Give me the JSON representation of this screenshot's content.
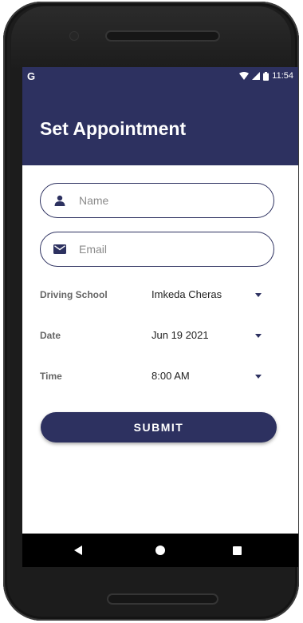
{
  "status_bar": {
    "carrier_glyph": "G",
    "time": "11:54",
    "icons": [
      "wifi-icon",
      "signal-icon",
      "battery-icon"
    ]
  },
  "app_bar": {
    "title": "Set Appointment"
  },
  "form": {
    "name": {
      "placeholder": "Name",
      "value": "",
      "icon": "person-icon"
    },
    "email": {
      "placeholder": "Email",
      "value": "",
      "icon": "mail-icon"
    },
    "driving_school": {
      "label": "Driving School",
      "value": "Imkeda Cheras"
    },
    "date": {
      "label": "Date",
      "value": "Jun 19 2021"
    },
    "time": {
      "label": "Time",
      "value": "8:00 AM"
    },
    "submit_label": "SUBMIT"
  },
  "nav_bar": {
    "icons": [
      "back-icon",
      "home-icon",
      "recents-icon"
    ]
  },
  "colors": {
    "primary": "#2d3160",
    "device": "#1c1c1c",
    "background": "#ffffff"
  }
}
